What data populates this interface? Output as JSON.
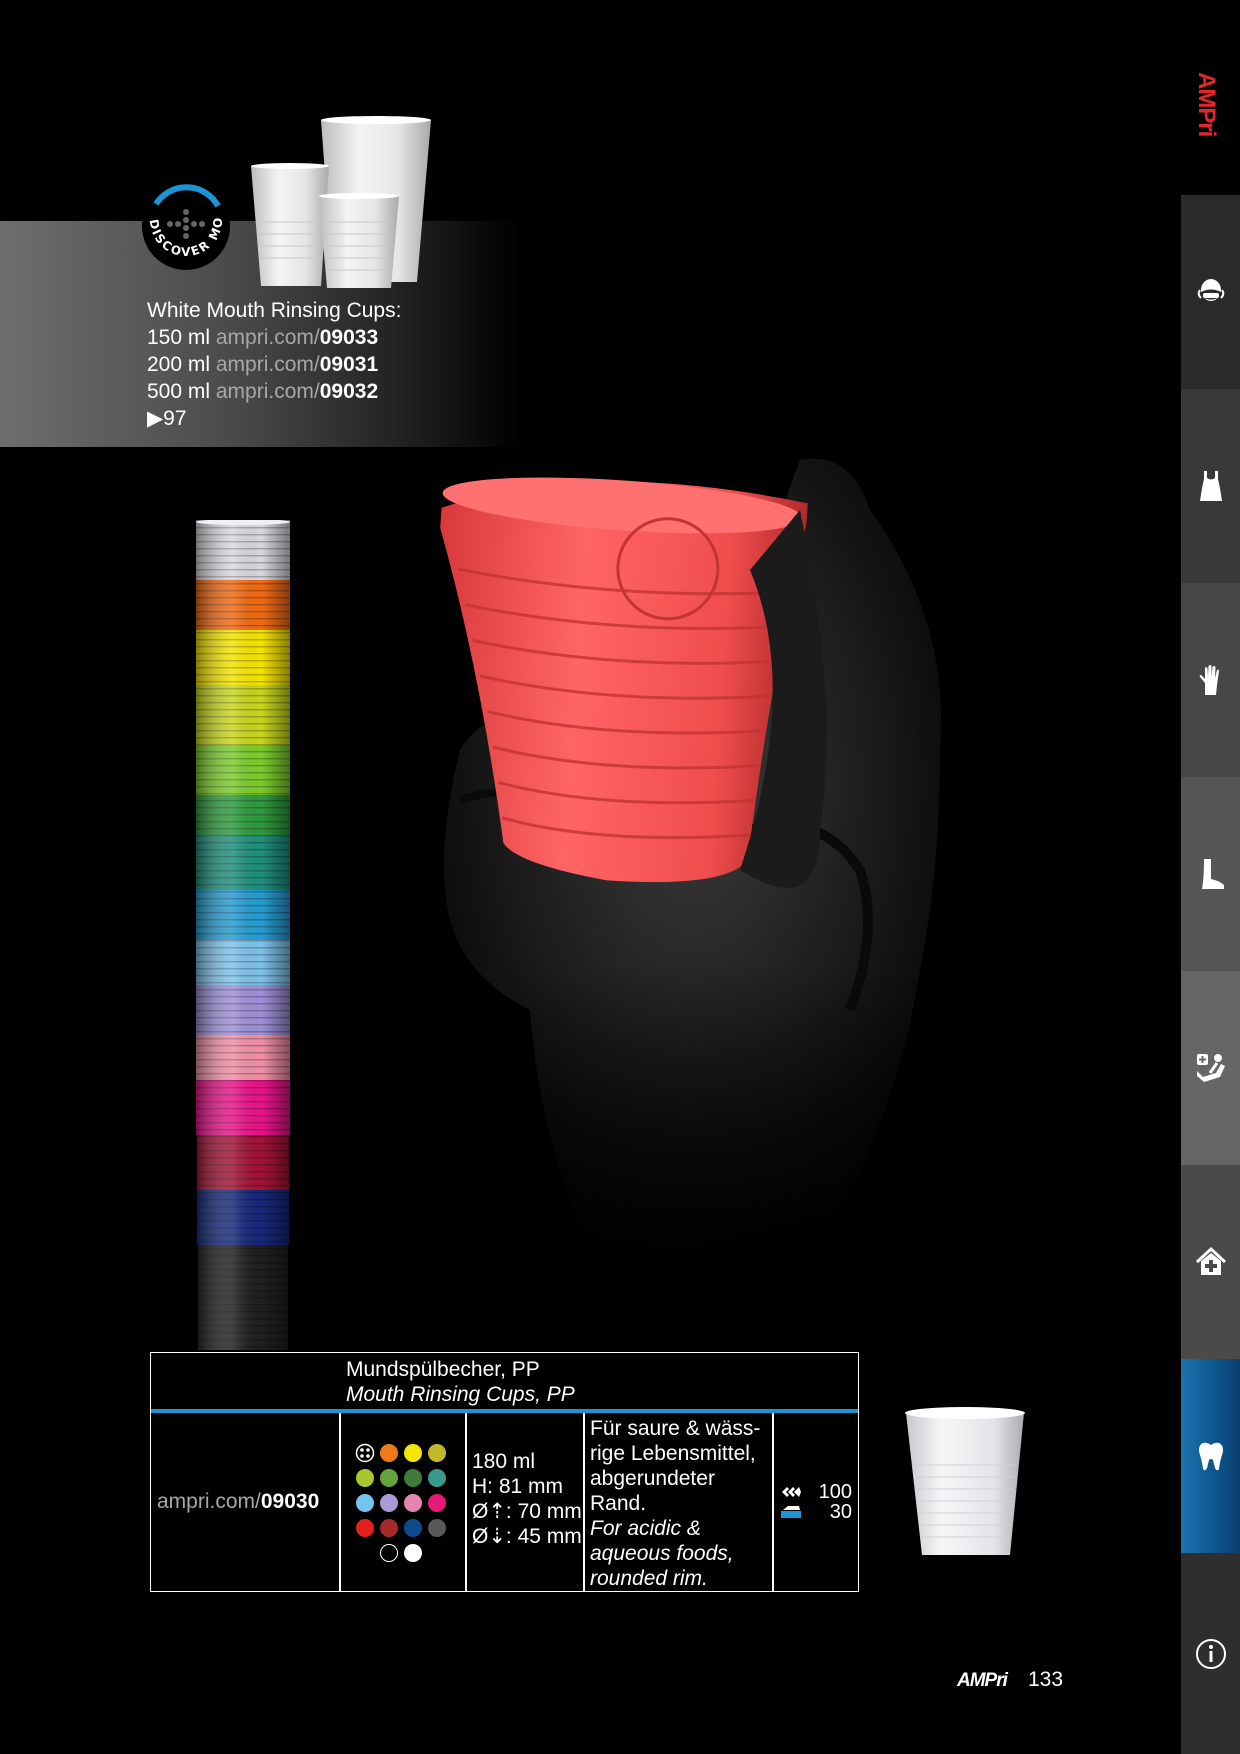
{
  "brand": {
    "name": "AMPri",
    "accent": "#e3262b"
  },
  "sidebar": {
    "tabs": [
      {
        "icon": "face-mask-icon",
        "bg": "#2b2b2b"
      },
      {
        "icon": "apron-icon",
        "bg": "#3a3a3a"
      },
      {
        "icon": "glove-icon",
        "bg": "#484848"
      },
      {
        "icon": "boot-cover-icon",
        "bg": "#575757"
      },
      {
        "icon": "patient-chair-icon",
        "bg": "#686868"
      },
      {
        "icon": "medical-home-icon",
        "bg": "#4a4a4a"
      },
      {
        "icon": "tooth-icon",
        "bg": "#1b6ea8",
        "active": true
      },
      {
        "icon": "info-icon",
        "bg": "#2f2f2f"
      }
    ]
  },
  "discover": {
    "label": "DISCOVER MORE"
  },
  "banner": {
    "title": "White Mouth Rinsing Cups:",
    "items": [
      {
        "size": "150 ml",
        "url": "ampri.com/",
        "code": "09033"
      },
      {
        "size": "200 ml",
        "url": "ampri.com/",
        "code": "09031"
      },
      {
        "size": "500 ml",
        "url": "ampri.com/",
        "code": "09032"
      }
    ],
    "page_ref": "▶97"
  },
  "product": {
    "title_de": "Mundspülbecher, PP",
    "title_en": "Mouth Rinsing Cups, PP",
    "url": "ampri.com/",
    "code": "09030",
    "dims": [
      "180 ml",
      "H: 81 mm",
      "Ø⇡: 70 mm",
      "Ø⇣: 45 mm"
    ],
    "desc_de": [
      "Für saure & wäss-",
      "rige Lebensmittel,",
      "abgerundeter",
      "Rand."
    ],
    "desc_en": [
      "For acidic &",
      "aqueous foods,",
      "rounded rim."
    ],
    "pack_inner": "100",
    "pack_outer": "30",
    "colors": [
      "#f07a17",
      "#f2e600",
      "#c3b72a",
      "#a8c62b",
      "#64a33d",
      "#3e7a3a",
      "#3a9a8b",
      "#74c4ef",
      "#a99bd6",
      "#e684b2",
      "#e5197a",
      "#e3211e",
      "#a52b2b",
      "#0e4a8d",
      "#585858",
      "#000000",
      "#ffffff"
    ]
  },
  "footer": {
    "brand": "AMPri",
    "page": "133"
  }
}
